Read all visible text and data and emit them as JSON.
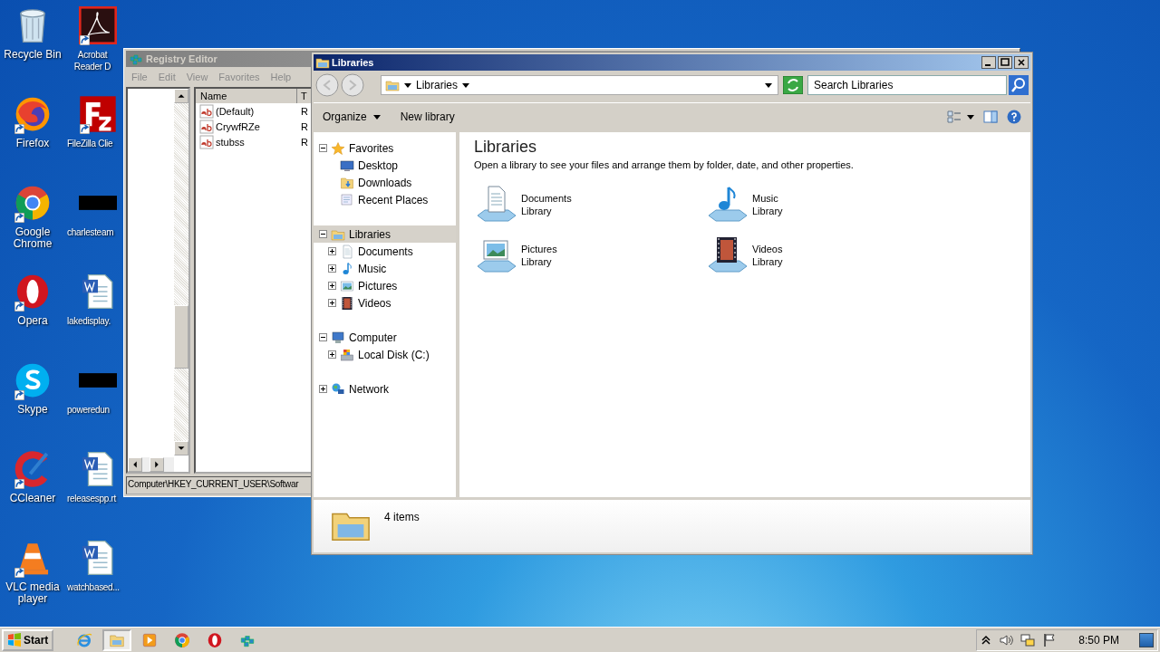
{
  "desktop_icons": [
    {
      "label": "Recycle Bin",
      "kind": "recycle",
      "shortcut": false
    },
    {
      "label": "Firefox",
      "kind": "firefox",
      "shortcut": true
    },
    {
      "label": "Google Chrome",
      "kind": "chrome",
      "shortcut": true
    },
    {
      "label": "Opera",
      "kind": "opera",
      "shortcut": true
    },
    {
      "label": "Skype",
      "kind": "skype",
      "shortcut": true
    },
    {
      "label": "CCleaner",
      "kind": "ccleaner",
      "shortcut": true
    },
    {
      "label": "VLC media player",
      "kind": "vlc",
      "shortcut": true
    },
    {
      "label": "Acrobat Reader D",
      "kind": "acrobat",
      "shortcut": true
    },
    {
      "label": "FileZilla Clie",
      "kind": "filezilla",
      "shortcut": true
    },
    {
      "label": "charlesteam",
      "kind": "redacted",
      "shortcut": false
    },
    {
      "label": "lakedisplay.",
      "kind": "word",
      "shortcut": false
    },
    {
      "label": "poweredun",
      "kind": "redacted",
      "shortcut": false
    },
    {
      "label": "releasespp.rt",
      "kind": "word",
      "shortcut": false
    },
    {
      "label": "watchbased...",
      "kind": "word",
      "shortcut": false
    }
  ],
  "registry_editor": {
    "title": "Registry Editor",
    "menu": [
      "File",
      "Edit",
      "View",
      "Favorites",
      "Help"
    ],
    "columns": [
      "Name",
      "T"
    ],
    "values": [
      {
        "name": "(Default)",
        "type": "R"
      },
      {
        "name": "CrywfRZe",
        "type": "R"
      },
      {
        "name": "stubss",
        "type": "R"
      }
    ],
    "status_bar": "Computer\\HKEY_CURRENT_USER\\Softwar"
  },
  "explorer": {
    "title": "Libraries",
    "breadcrumb": "Libraries",
    "search": {
      "placeholder": "Search Libraries"
    },
    "toolbar": [
      "Organize",
      "New library"
    ],
    "nav": [
      {
        "label": "Favorites",
        "kind": "star",
        "expanded": true,
        "selected": false,
        "children": [
          {
            "label": "Desktop",
            "kind": "desktop",
            "selected": false
          },
          {
            "label": "Downloads",
            "kind": "downloads",
            "selected": false
          },
          {
            "label": "Recent Places",
            "kind": "recent",
            "selected": false
          }
        ]
      },
      {
        "label": "Libraries",
        "kind": "libraries",
        "expanded": true,
        "selected": true,
        "children": [
          {
            "label": "Documents",
            "kind": "documents",
            "expanded": false,
            "selected": false
          },
          {
            "label": "Music",
            "kind": "music",
            "expanded": false,
            "selected": false
          },
          {
            "label": "Pictures",
            "kind": "pictures",
            "expanded": false,
            "selected": false
          },
          {
            "label": "Videos",
            "kind": "videos",
            "expanded": false,
            "selected": false
          }
        ]
      },
      {
        "label": "Computer",
        "kind": "computer",
        "expanded": true,
        "selected": false,
        "children": [
          {
            "label": "Local Disk (C:)",
            "kind": "disk",
            "expanded": false,
            "selected": false
          }
        ]
      },
      {
        "label": "Network",
        "kind": "network",
        "expanded": false,
        "selected": false
      }
    ],
    "heading": "Libraries",
    "description": "Open a library to see your files and arrange them by folder, date, and other properties.",
    "libraries": [
      {
        "name": "Documents",
        "type": "Library",
        "kind": "documents"
      },
      {
        "name": "Music",
        "type": "Library",
        "kind": "music"
      },
      {
        "name": "Pictures",
        "type": "Library",
        "kind": "pictures"
      },
      {
        "name": "Videos",
        "type": "Library",
        "kind": "videos"
      }
    ],
    "item_count": "4 items"
  },
  "taskbar": {
    "start": "Start",
    "apps": [
      {
        "kind": "ie",
        "selected": false
      },
      {
        "kind": "explorer",
        "selected": true
      },
      {
        "kind": "media",
        "selected": false
      },
      {
        "kind": "chrome",
        "selected": false
      },
      {
        "kind": "opera",
        "selected": false
      },
      {
        "kind": "regedit",
        "selected": false
      }
    ],
    "clock": "8:50 PM"
  }
}
